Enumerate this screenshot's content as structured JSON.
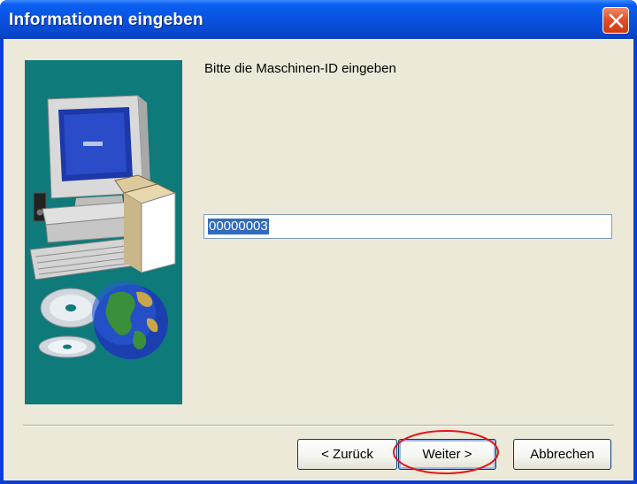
{
  "window": {
    "title": "Informationen eingeben"
  },
  "prompt": {
    "text": "Bitte die Maschinen-ID eingeben"
  },
  "machine_id": {
    "value": "00000003",
    "selected": true
  },
  "buttons": {
    "back_label": "< Zurück",
    "next_label": "Weiter >",
    "cancel_label": "Abbrechen"
  },
  "icons": {
    "close": "close-icon",
    "illustration": "computer-globe-illustration"
  },
  "colors": {
    "title_bar": "#0a52e0",
    "dialog_bg": "#ece9d8",
    "side_panel": "#0e7a7a",
    "selection": "#316ac5",
    "highlight_ring": "#e01818"
  }
}
